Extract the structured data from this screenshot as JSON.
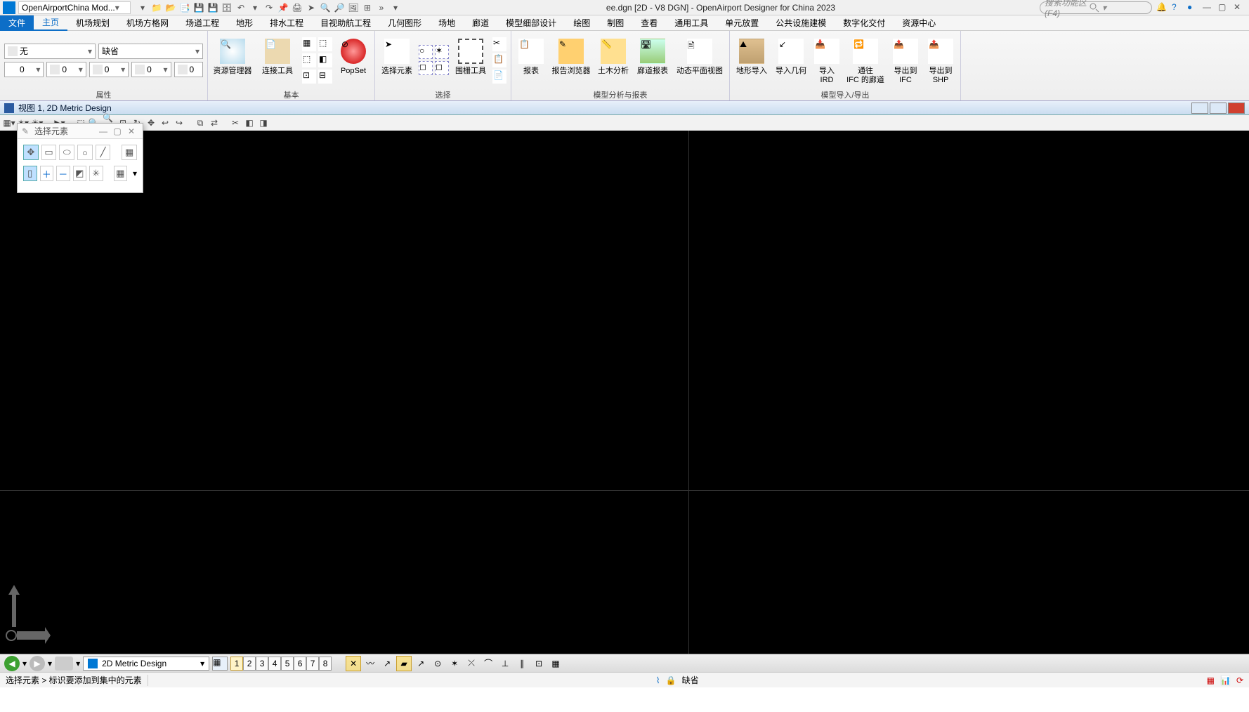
{
  "title": "ee.dgn [2D - V8 DGN] - OpenAirport Designer for China 2023",
  "workflow": "OpenAirportChina Mod...",
  "search_placeholder": "搜索功能区(F4)",
  "menu": {
    "file": "文件",
    "items": [
      "主页",
      "机场规划",
      "机场方格网",
      "场道工程",
      "地形",
      "排水工程",
      "目视助航工程",
      "几何图形",
      "场地",
      "廊道",
      "模型细部设计",
      "绘图",
      "制图",
      "查看",
      "通用工具",
      "单元放置",
      "公共设施建模",
      "数字化交付",
      "资源中心"
    ]
  },
  "attributes": {
    "level": "无",
    "effect": "缺省",
    "num1": "0",
    "num2": "0",
    "num3": "0",
    "num4": "0",
    "num5": "0",
    "group": "属性"
  },
  "groups": {
    "primary": "基本",
    "select": "选择",
    "model": "模型分析与报表",
    "io": "模型导入/导出"
  },
  "buttons": {
    "res_mgr": "资源管理器",
    "link_tool": "连接工具",
    "popset": "PopSet",
    "sel_elem": "选择元素",
    "fence": "围栅工具",
    "report": "报表",
    "report_browser": "报告浏览器",
    "civil_analysis": "土木分析",
    "corridor_report": "廊道报表",
    "dyn_plan": "动态平面视图",
    "terrain_import": "地形导入",
    "import_geom": "导入几何",
    "import_ird": "导入\nIRD",
    "corridor_ifc": "通往\nIFC 的廊道",
    "export_ifc": "导出到\nIFC",
    "export_shp": "导出到\nSHP"
  },
  "view": {
    "title": "视图 1, 2D Metric Design"
  },
  "floating": {
    "title": "选择元素"
  },
  "bottom": {
    "model": "2D Metric Design",
    "views": [
      "1",
      "2",
      "3",
      "4",
      "5",
      "6",
      "7",
      "8"
    ]
  },
  "status": {
    "left": "选择元素  >  标识要添加到集中的元素",
    "lock": "缺省"
  }
}
